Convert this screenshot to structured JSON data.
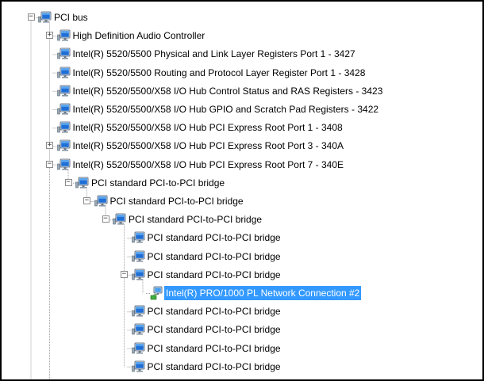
{
  "colors": {
    "selection_background": "#3399ff",
    "selection_text": "#ffffff",
    "tree_lines": "#a0a0a0",
    "monitor_blue": "#1f6fd6"
  },
  "tree": {
    "items": [
      {
        "label": "PCI bus",
        "depth": 0,
        "expander": "minus",
        "icon": "computer-monitor-icon"
      },
      {
        "label": "High Definition Audio Controller",
        "depth": 1,
        "expander": "plus",
        "icon": "device-monitor-icon"
      },
      {
        "label": "Intel(R) 5520/5500 Physical and Link Layer Registers Port 1 - 3427",
        "depth": 1,
        "expander": "none",
        "icon": "device-monitor-icon"
      },
      {
        "label": "Intel(R) 5520/5500 Routing and Protocol Layer Register Port 1 - 3428",
        "depth": 1,
        "expander": "none",
        "icon": "device-monitor-icon"
      },
      {
        "label": "Intel(R) 5520/5500/X58 I/O Hub Control Status and RAS Registers - 3423",
        "depth": 1,
        "expander": "none",
        "icon": "device-monitor-icon"
      },
      {
        "label": "Intel(R) 5520/5500/X58 I/O Hub GPIO and Scratch Pad Registers - 3422",
        "depth": 1,
        "expander": "none",
        "icon": "device-monitor-icon"
      },
      {
        "label": "Intel(R) 5520/5500/X58 I/O Hub PCI Express Root Port 1 - 3408",
        "depth": 1,
        "expander": "none",
        "icon": "device-monitor-icon"
      },
      {
        "label": "Intel(R) 5520/5500/X58 I/O Hub PCI Express Root Port 3 - 340A",
        "depth": 1,
        "expander": "plus",
        "icon": "device-monitor-icon"
      },
      {
        "label": "Intel(R) 5520/5500/X58 I/O Hub PCI Express Root Port 7 - 340E",
        "depth": 1,
        "expander": "minus",
        "icon": "device-monitor-icon"
      },
      {
        "label": "PCI standard PCI-to-PCI bridge",
        "depth": 2,
        "expander": "minus",
        "icon": "device-monitor-icon"
      },
      {
        "label": "PCI standard PCI-to-PCI bridge",
        "depth": 3,
        "expander": "minus",
        "icon": "device-monitor-icon"
      },
      {
        "label": "PCI standard PCI-to-PCI bridge",
        "depth": 4,
        "expander": "minus",
        "icon": "device-monitor-icon"
      },
      {
        "label": "PCI standard PCI-to-PCI bridge",
        "depth": 5,
        "expander": "none",
        "icon": "device-monitor-icon"
      },
      {
        "label": "PCI standard PCI-to-PCI bridge",
        "depth": 5,
        "expander": "none",
        "icon": "device-monitor-icon"
      },
      {
        "label": "PCI standard PCI-to-PCI bridge",
        "depth": 5,
        "expander": "minus",
        "icon": "device-monitor-icon"
      },
      {
        "label": "Intel(R) PRO/1000 PL Network Connection #2",
        "depth": 6,
        "expander": "none",
        "icon": "network-adapter-icon",
        "selected": true
      },
      {
        "label": "PCI standard PCI-to-PCI bridge",
        "depth": 5,
        "expander": "none",
        "icon": "device-monitor-icon"
      },
      {
        "label": "PCI standard PCI-to-PCI bridge",
        "depth": 5,
        "expander": "none",
        "icon": "device-monitor-icon"
      },
      {
        "label": "PCI standard PCI-to-PCI bridge",
        "depth": 5,
        "expander": "none",
        "icon": "device-monitor-icon"
      },
      {
        "label": "PCI standard PCI-to-PCI bridge",
        "depth": 5,
        "expander": "none",
        "icon": "device-monitor-icon"
      }
    ]
  }
}
